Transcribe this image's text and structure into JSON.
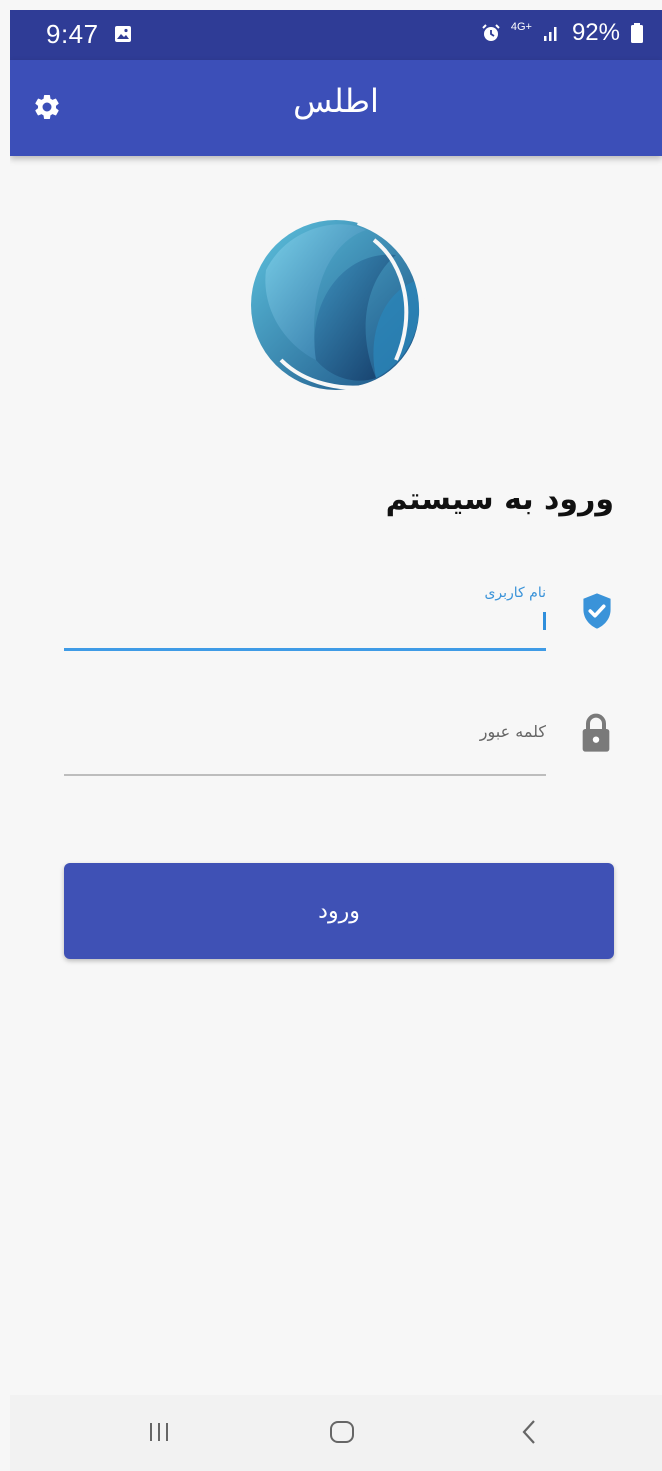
{
  "status_bar": {
    "time": "9:47",
    "network": "4G+",
    "battery": "92%",
    "icons": [
      "gallery-icon",
      "alarm-icon",
      "network-4g-icon",
      "signal-icon",
      "battery-icon"
    ]
  },
  "app_bar": {
    "title": "اطلس",
    "settings_icon": "gear-icon"
  },
  "login": {
    "heading": "ورود به سیستم",
    "username_label": "نام کاربری",
    "username_value": "",
    "password_placeholder": "کلمه عبور",
    "submit_label": "ورود"
  },
  "nav_bar": {
    "items": [
      "recent-apps-icon",
      "home-icon",
      "back-icon"
    ]
  },
  "colors": {
    "status_bar": "#2f3c96",
    "app_bar": "#3c4fb8",
    "accent": "#3f9be6",
    "button": "#3f51b5",
    "background": "#f7f7f7"
  }
}
